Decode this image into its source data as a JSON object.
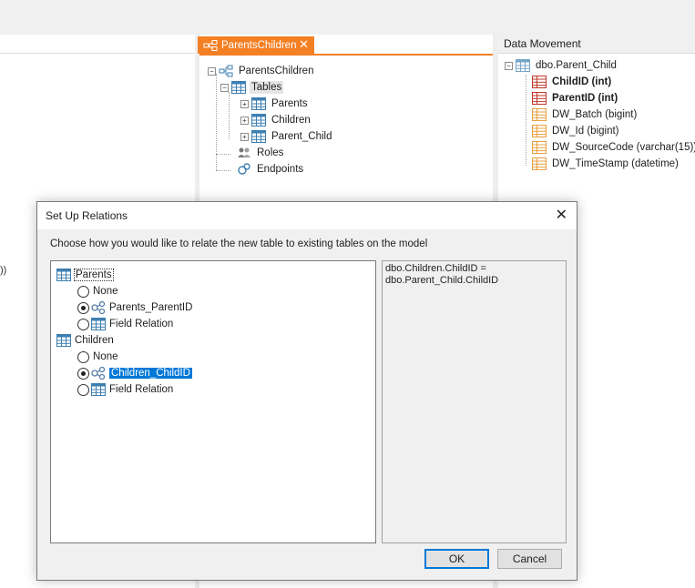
{
  "left_fragment": "))",
  "document_tab": {
    "label": "ParentsChildren"
  },
  "model_tree": {
    "root": "ParentsChildren",
    "tables_label": "Tables",
    "tables": [
      "Parents",
      "Children",
      "Parent_Child"
    ],
    "roles_label": "Roles",
    "endpoints_label": "Endpoints"
  },
  "data_movement": {
    "header": "Data Movement",
    "table": "dbo.Parent_Child",
    "fields": [
      {
        "label": "ChildID (int)",
        "key": true
      },
      {
        "label": "ParentID (int)",
        "key": true
      },
      {
        "label": "DW_Batch (bigint)",
        "key": false
      },
      {
        "label": "DW_Id (bigint)",
        "key": false
      },
      {
        "label": "DW_SourceCode (varchar(15))",
        "key": false
      },
      {
        "label": "DW_TimeStamp (datetime)",
        "key": false
      }
    ]
  },
  "dialog": {
    "title": "Set Up Relations",
    "close_glyph": "✕",
    "instruction": "Choose how you would like to relate the new table to existing tables on the model",
    "groups": [
      {
        "table": "Parents",
        "options": [
          {
            "label": "None",
            "kind": "none",
            "selected": false
          },
          {
            "label": "Parents_ParentID",
            "kind": "relation",
            "selected": true
          },
          {
            "label": "Field Relation",
            "kind": "field",
            "selected": false
          }
        ]
      },
      {
        "table": "Children",
        "options": [
          {
            "label": "None",
            "kind": "none",
            "selected": false
          },
          {
            "label": "Children_ChildID",
            "kind": "relation",
            "selected": true
          },
          {
            "label": "Field Relation",
            "kind": "field",
            "selected": false
          }
        ]
      }
    ],
    "expression_lines": [
      "dbo.Children.ChildID =",
      "dbo.Parent_Child.ChildID"
    ],
    "ok_label": "OK",
    "cancel_label": "Cancel"
  },
  "colors": {
    "accent_orange": "#f48024",
    "selection_blue": "#0078d7",
    "table_icon_blue": "#3c7fb1",
    "field_icon_orange": "#e8a040"
  }
}
